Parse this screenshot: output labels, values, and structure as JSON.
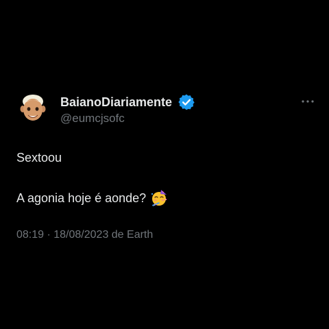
{
  "author": {
    "display_name": "BaianoDiariamente",
    "handle": "@eumcjsofc",
    "verified": true,
    "avatar_icon": "memoji-avatar-icon",
    "verified_icon": "verified-badge-icon",
    "verified_color": "#1d9bf0"
  },
  "menu": {
    "icon": "more-options-icon"
  },
  "tweet": {
    "line1": "Sextoou",
    "line2": "A agonia hoje é aonde?",
    "emoji_icon": "partying-face-icon"
  },
  "meta": {
    "timestamp": "08:19 · 18/08/2023 de Earth"
  },
  "colors": {
    "background": "#000000",
    "primary_text": "#e7e9ea",
    "secondary_text": "#71767b"
  }
}
